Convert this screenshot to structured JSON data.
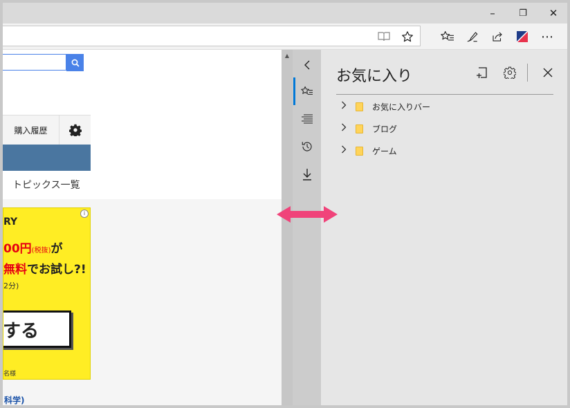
{
  "window": {
    "minimize_glyph": "–",
    "restore_glyph": "❐",
    "close_glyph": "✕"
  },
  "toolbar": {
    "icons": [
      "reading-view-icon",
      "add-favorite-star-icon",
      "favorites-hub-icon",
      "web-note-pen-icon",
      "share-icon",
      "flag-icon",
      "more-icon"
    ],
    "more_glyph": "⋯"
  },
  "page": {
    "purchase_history_tab": "購入履歴",
    "topics_link": "トピックス一覧",
    "ad": {
      "line1": "RY",
      "line2_price": "00円",
      "line2_tax": "(税抜)",
      "line2_tail": "が",
      "line3_highlight": "無料",
      "line3_tail": "でお試し?!",
      "line4": "2分)",
      "cta": "する",
      "footnote": "名様",
      "info_glyph": "i"
    },
    "science_link": "科学)"
  },
  "hub": {
    "buttons": [
      "back-chevron-icon",
      "favorites-icon",
      "reading-list-icon",
      "history-icon",
      "downloads-icon"
    ]
  },
  "favorites_pane": {
    "title": "お気に入り",
    "items": [
      {
        "label": "お気に入りバー"
      },
      {
        "label": "ブログ"
      },
      {
        "label": "ゲーム"
      }
    ]
  },
  "colors": {
    "accent": "#0078d7",
    "search_button": "#4a82e8",
    "ad_background": "#ffed24",
    "ad_red": "#e60012",
    "resize_arrow": "#f0437a",
    "folder": "#ffd45a"
  }
}
